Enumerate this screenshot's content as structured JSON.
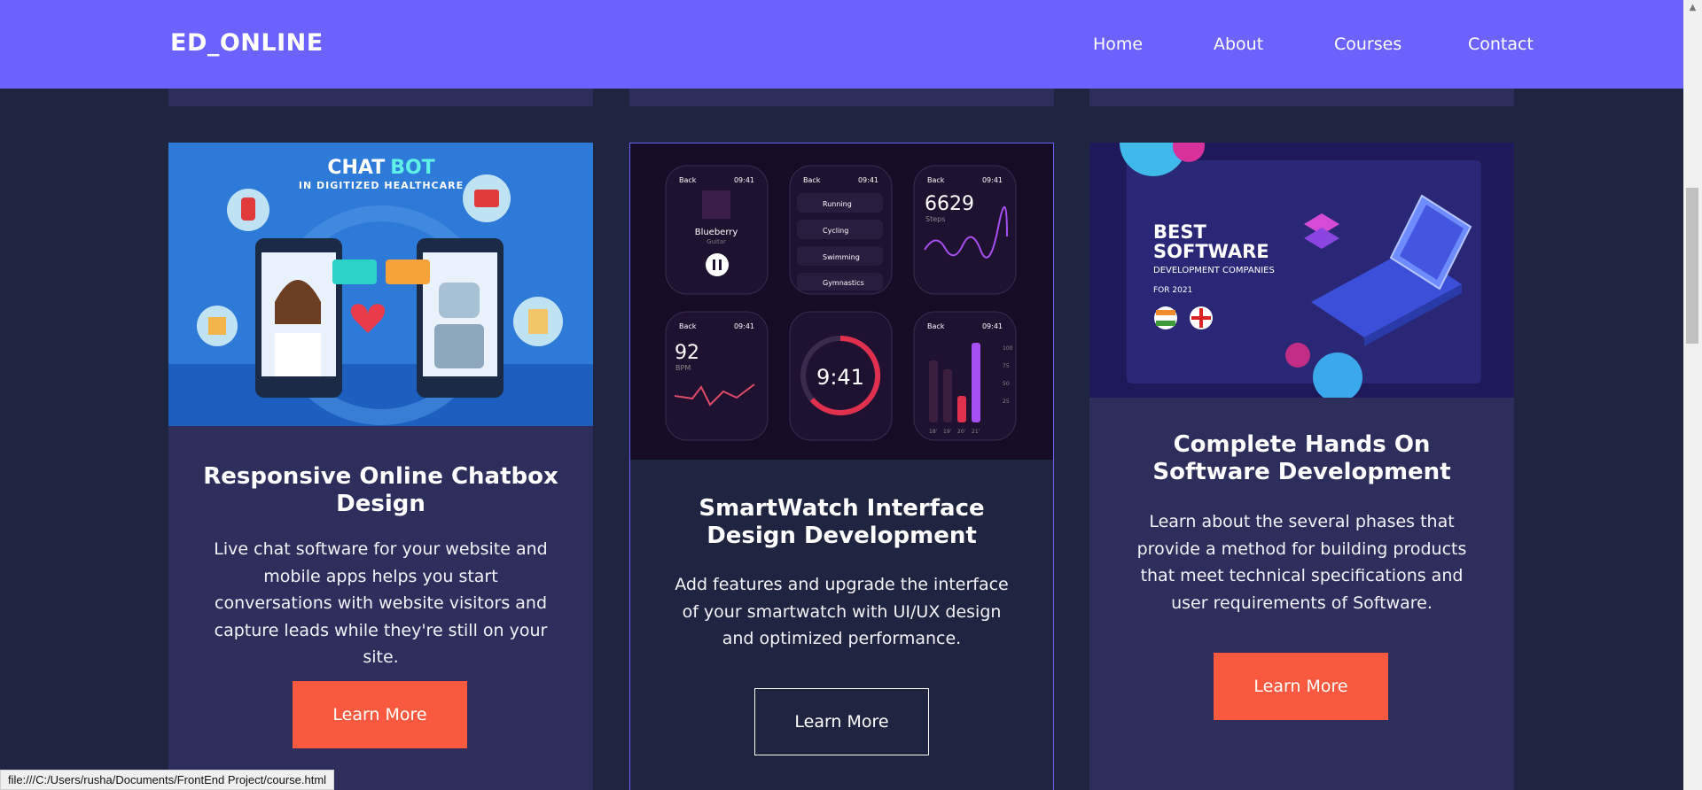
{
  "brand": "ED_ONLINE",
  "nav": {
    "home": "Home",
    "about": "About",
    "courses": "Courses",
    "contact": "Contact"
  },
  "cards": [
    {
      "title": "Responsive Online Chatbox Design",
      "description": "Live chat software for your website and mobile apps helps you start conversations with website visitors and capture leads while they're still on your site.",
      "button": "Learn More",
      "image": {
        "heading_1": "CHAT",
        "heading_2": "BOT",
        "subheading": "IN DIGITIZED HEALTHCARE"
      }
    },
    {
      "title": "SmartWatch Interface Design Development",
      "description": "Add features and upgrade the interface of your smartwatch with UI/UX design and optimized performance.",
      "button": "Learn More",
      "image": {
        "back": "Back",
        "time": "09:41",
        "song": "Blueberry",
        "artist": "Guitar",
        "activities": [
          "Running",
          "Cycling",
          "Swimming",
          "Gymnastics"
        ],
        "steps": "6629",
        "steps_label": "Steps",
        "bpm": "92",
        "bpm_label": "BPM",
        "big_time": "9:41",
        "axis_right": [
          "100",
          "75",
          "50",
          "25"
        ],
        "axis_bottom": [
          "18'",
          "19'",
          "20'",
          "21'"
        ]
      }
    },
    {
      "title": "Complete Hands On Software Development",
      "description": "Learn about the several phases that provide a method for building products that meet technical specifications and user requirements of Software.",
      "button": "Learn More",
      "image": {
        "line1": "BEST",
        "line2": "SOFTWARE",
        "line3": "DEVELOPMENT COMPANIES",
        "line4": "FOR 2021"
      }
    }
  ],
  "status_url": "file:///C:/Users/rusha/Documents/FrontEnd Project/course.html",
  "colors": {
    "navbar": "#6c63ff",
    "background": "#1f2440",
    "card": "#2d2e5c",
    "button": "#f95a3f"
  }
}
